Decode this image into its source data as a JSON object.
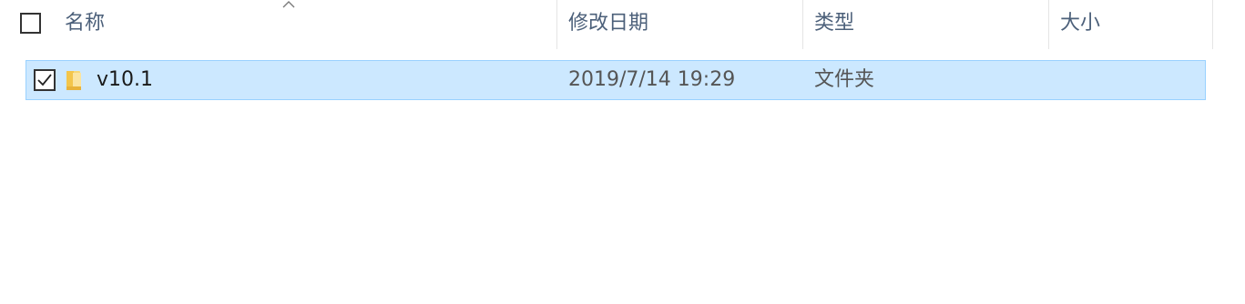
{
  "header": {
    "select_all_checked": false,
    "sort_indicator": "sort-ascending-icon",
    "columns": [
      {
        "label": "名称"
      },
      {
        "label": "修改日期"
      },
      {
        "label": "类型"
      },
      {
        "label": "大小"
      }
    ]
  },
  "rows": [
    {
      "checked": true,
      "icon": "folder-icon",
      "name": "v10.1",
      "modified": "2019/7/14 19:29",
      "type": "文件夹",
      "size": ""
    }
  ],
  "colors": {
    "selection_bg": "#cce8ff",
    "selection_border": "#99d1ff",
    "header_text": "#4c607a",
    "folder": "#f3c54b"
  }
}
